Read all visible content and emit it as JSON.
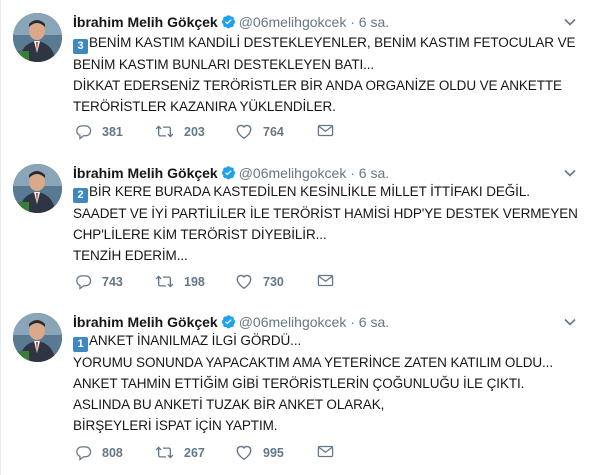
{
  "tweets": [
    {
      "name": "İbrahim Melih Gökçek",
      "handle": "@06melihgokcek",
      "separator": "·",
      "time": "6 sa.",
      "number": "3",
      "lines": [
        "BENİM KASTIM KANDİLİ DESTEKLEYENLER, BENİM KASTIM FETOCULAR VE",
        "BENİM KASTIM BUNLARI DESTEKLEYEN BATI...",
        "DİKKAT EDERSENİZ TERÖRİSTLER BİR ANDA ORGANİZE OLDU VE ANKETTE",
        "TERÖRİSTLER KAZANIRA YÜKLENDİLER."
      ],
      "replies": "381",
      "retweets": "203",
      "likes": "764"
    },
    {
      "name": "İbrahim Melih Gökçek",
      "handle": "@06melihgokcek",
      "separator": "·",
      "time": "6 sa.",
      "number": "2",
      "lines": [
        "BİR KERE BURADA KASTEDİLEN KESİNLİKLE MİLLET İTTİFAKI DEĞİL.",
        "SAADET VE İYİ PARTİLİLER İLE TERÖRİST HAMİSİ HDP'YE DESTEK VERMEYEN",
        "CHP'LİLERE KİM TERÖRİST DİYEBİLİR...",
        "TENZİH EDERİM..."
      ],
      "replies": "743",
      "retweets": "198",
      "likes": "730"
    },
    {
      "name": "İbrahim Melih Gökçek",
      "handle": "@06melihgokcek",
      "separator": "·",
      "time": "6 sa.",
      "number": "1",
      "lines": [
        "ANKET İNANILMAZ İLGİ GÖRDÜ...",
        "YORUMU SONUNDA YAPACAKTIM AMA YETERİNCE ZATEN KATILIM OLDU...",
        "ANKET TAHMİN ETTİĞİM GİBİ TERÖRİSTLERİN ÇOĞUNLUĞU İLE ÇIKTI.",
        "ASLINDA BU ANKETİ TUZAK BİR ANKET OLARAK,",
        "BİRŞEYLERİ İSPAT İÇİN YAPTIM."
      ],
      "replies": "808",
      "retweets": "267",
      "likes": "995"
    }
  ],
  "icons": {
    "verified": "verified-badge-icon",
    "caret": "chevron-down-icon",
    "reply": "reply-icon",
    "retweet": "retweet-icon",
    "like": "heart-icon",
    "message": "envelope-icon"
  },
  "colors": {
    "verified": "#1da1f2",
    "keycap": "#3b88c3",
    "muted": "#657786",
    "divider": "#e6ecf0"
  }
}
